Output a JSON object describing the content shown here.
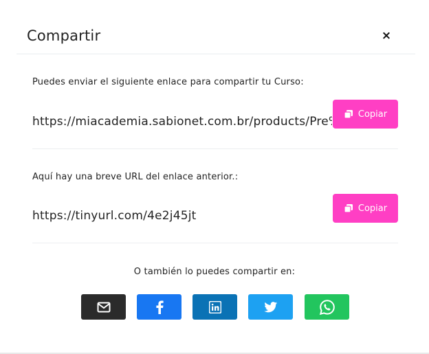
{
  "modal": {
    "title": "Compartir",
    "close_label": "×"
  },
  "link_section": {
    "description": "Puedes enviar el siguiente enlace para compartir tu Curso:",
    "url": "https://miacademia.sabionet.com.br/products/Pre%",
    "copy_label": "Copiar"
  },
  "short_section": {
    "description": "Aquí hay una breve URL del enlace anterior.:",
    "url": "https://tinyurl.com/4e2j45jt",
    "copy_label": "Copiar"
  },
  "share": {
    "text": "O también lo puedes compartir en:",
    "buttons": [
      {
        "name": "email",
        "icon": "envelope-icon",
        "color": "#2b2b2b"
      },
      {
        "name": "facebook",
        "icon": "facebook-icon",
        "color": "#1877f2"
      },
      {
        "name": "linkedin",
        "icon": "linkedin-icon",
        "color": "#0a72b5"
      },
      {
        "name": "twitter",
        "icon": "twitter-icon",
        "color": "#1da1f2"
      },
      {
        "name": "whatsapp",
        "icon": "whatsapp-icon",
        "color": "#22c55e"
      }
    ]
  },
  "colors": {
    "accent": "#ff3fc4"
  }
}
